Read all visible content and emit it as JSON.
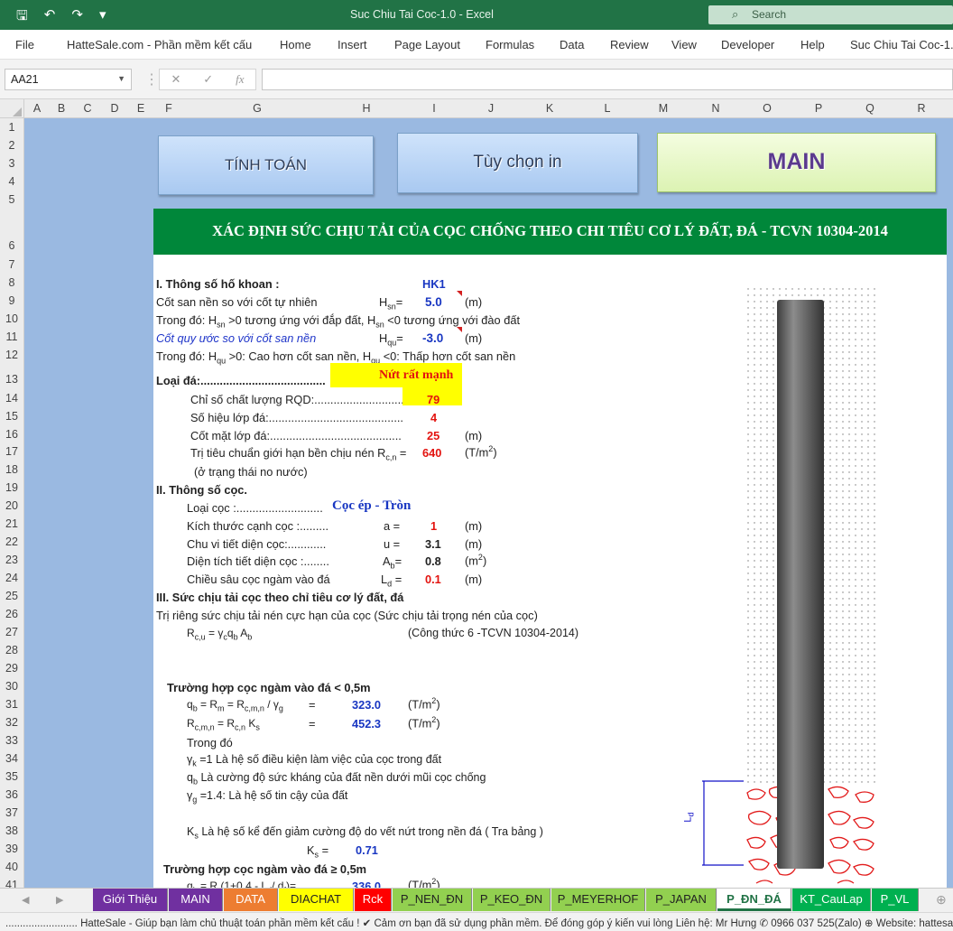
{
  "titlebar": {
    "title": "Suc Chiu Tai Coc-1.0  -  Excel",
    "search_placeholder": "Search",
    "save_icon": "save-icon",
    "undo_icon": "undo-icon",
    "redo_icon": "redo-icon",
    "customize_icon": "customize-qat-icon"
  },
  "menu": [
    "File",
    "HatteSale.com - Phần mềm kết cấu",
    "Home",
    "Insert",
    "Page Layout",
    "Formulas",
    "Data",
    "Review",
    "View",
    "Developer",
    "Help",
    "Suc Chiu Tai Coc-1.0"
  ],
  "formula_bar": {
    "name_box": "AA21",
    "formula": "",
    "fx_label": "fx"
  },
  "columns": [
    "A",
    "B",
    "C",
    "D",
    "E",
    "F",
    "G",
    "H",
    "I",
    "J",
    "K",
    "L",
    "M",
    "N",
    "O",
    "P",
    "Q",
    "R"
  ],
  "rows": [
    "1",
    "2",
    "3",
    "4",
    "5",
    "6",
    "7",
    "8",
    "9",
    "10",
    "11",
    "12",
    "13",
    "14",
    "15",
    "16",
    "17",
    "18",
    "19",
    "20",
    "21",
    "22",
    "23",
    "24",
    "25",
    "26",
    "27",
    "28",
    "29",
    "30",
    "31",
    "32",
    "33",
    "34",
    "35",
    "36",
    "37",
    "38",
    "39",
    "40",
    "41",
    "42"
  ],
  "buttons": {
    "tinh_toan": "TÍNH TOÁN",
    "tuy_chon_in": "Tùy chọn in",
    "main": "MAIN"
  },
  "heading": "XÁC ĐỊNH SỨC CHỊU TẢI CỦA CỌC CHỐNG THEO CHI TIÊU CƠ LÝ ĐẤT, ĐÁ - TCVN 10304-2014",
  "sheet": {
    "s1": "I. Thông số hố khoan :",
    "hk": "HK1",
    "r9": "Cốt san nền so với cốt tự nhiên",
    "hsn_sym": "H",
    "hsn_sub": "sn",
    "hsn_val": "5.0",
    "unit_m": "(m)",
    "r10a": "Trong đó: H",
    "r10b": " >0 tương ứng với đắp đất, H",
    "r10c": " <0 tương ứng với đào đất",
    "r11": "Cốt quy ước so với cốt san nền",
    "hqu_sub": "qu",
    "hqu_val": "-3.0",
    "r12a": "Trong đó: H",
    "r12b": " >0: Cao hơn cốt san nền, H",
    "r12c": " <0: Thấp hơn cốt san nền",
    "loai_da": "Loại đá:.......................................",
    "loai_da_val": "Nứt rất mạnh",
    "rqd": "Chỉ số chất lượng RQD:............................",
    "rqd_val": "79",
    "so_hieu": "Số hiệu lớp đá:..........................................",
    "so_hieu_val": "4",
    "cot_mat": "Cốt mặt lớp đá:.........................................",
    "cot_mat_val": "25",
    "tri_tieu": "Trị tiêu chuẩn giới hạn bền chịu nén R",
    "tri_tieu_sub": "c,n",
    "tri_tieu_val": "640",
    "unit_tm2": "(T/m",
    "sup2": "2",
    "o_trang_thai": "(ở trạng thái no nước)",
    "s2": "II. Thông số cọc.",
    "loai_coc": "Loại  cọc :...........................",
    "loai_coc_val": "Cọc ép - Tròn",
    "kich_thuoc": "Kích thước cạnh cọc :.........",
    "a_sym": "a =",
    "a_val": "1",
    "chu_vi": "Chu vi tiết diện cọc:............",
    "u_sym": "u =",
    "u_val": "3.1",
    "dien_tich": "Diện tích tiết diện cọc :........",
    "ab_sym": "A",
    "ab_sub": "b",
    "ab_val": "0.8",
    "chieu_sau": "Chiều sâu cọc ngàm vào đá",
    "ld_sym": "L",
    "ld_sub": "d",
    "ld_val": "0.1",
    "s3": "III. Sức chịu tải cọc theo chỉ tiêu cơ lý đất, đá",
    "r27": "Trị riêng sức chịu tải nén cực hạn của cọc (Sức chịu tải trọng nén của cọc)",
    "rcu_formula": "R",
    "rcu_sub": "c,u",
    "rcu_rest": " = γ",
    "rcu_rest2": "q",
    "rcu_rest3": " A",
    "cong_thuc": "(Công thức 6 -TCVN 10304-2014)",
    "case1": "Trường hợp cọc ngàm vào đá < 0,5m",
    "qb_label": "q",
    "qb_rest": " = R",
    "qb_rest2": " = R",
    "qb_rest3": " / γ",
    "eq": "=",
    "qb_val": "323.0",
    "rcmn_label": "R",
    "rcmn_sub": "c,m,n",
    "rcmn_rest": " = R",
    "rcmn_rest2": " K",
    "rcmn_val": "452.3",
    "trong_do": "Trong đó",
    "gk_text": " =1 Là hệ số điều kiện làm việc của cọc trong đất",
    "qb_text": " Là cường độ sức kháng của đất nền dưới mũi cọc chống",
    "gg_text": " =1.4: Là hệ số tin cậy của đất",
    "ks_text": " Là hệ số kể đến giảm cường độ do vết nứt trong nền đá ( Tra bảng )",
    "ks_label": "K",
    "ks_eq": " =",
    "ks_val": "0.71",
    "case2": "Trường hợp cọc ngàm vào đá ≥ 0,5m",
    "r42": "q",
    "r42_rest": " = R",
    "r42_rest2": "   (1+0,4 - L",
    "r42_rest3": "/ d",
    "r42_rest4": ")=",
    "r42_val": "336.0",
    "diagram_label": "L",
    "diagram_sub": "d"
  },
  "tabs": [
    "Giới Thiệu",
    "MAIN",
    "DATA",
    "DIACHAT",
    "Rck",
    "P_NEN_ĐN",
    "P_KEO_ĐN",
    "P_MEYERHOF",
    "P_JAPAN",
    "P_ĐN_ĐÁ",
    "KT_CauLap",
    "P_VL"
  ],
  "tab_colors": [
    "#7030a0",
    "#7030a0",
    "#ed7d31",
    "#ffff00",
    "#ff0000",
    "#92d050",
    "#92d050",
    "#92d050",
    "#92d050",
    "#ffffff",
    "#00b050",
    "#00b050"
  ],
  "active_tab": "P_ĐN_ĐÁ",
  "status": "......................... HatteSale - Giúp bạn làm chủ thuật toán phần mềm kết cấu ! ✔ Cảm ơn bạn đã sử dụng phần mềm. Để đóng góp ý kiến vui lòng Liên hệ: Mr Hưng ✆ 0966 037 525(Zalo) ⊕ Website: hattesale"
}
